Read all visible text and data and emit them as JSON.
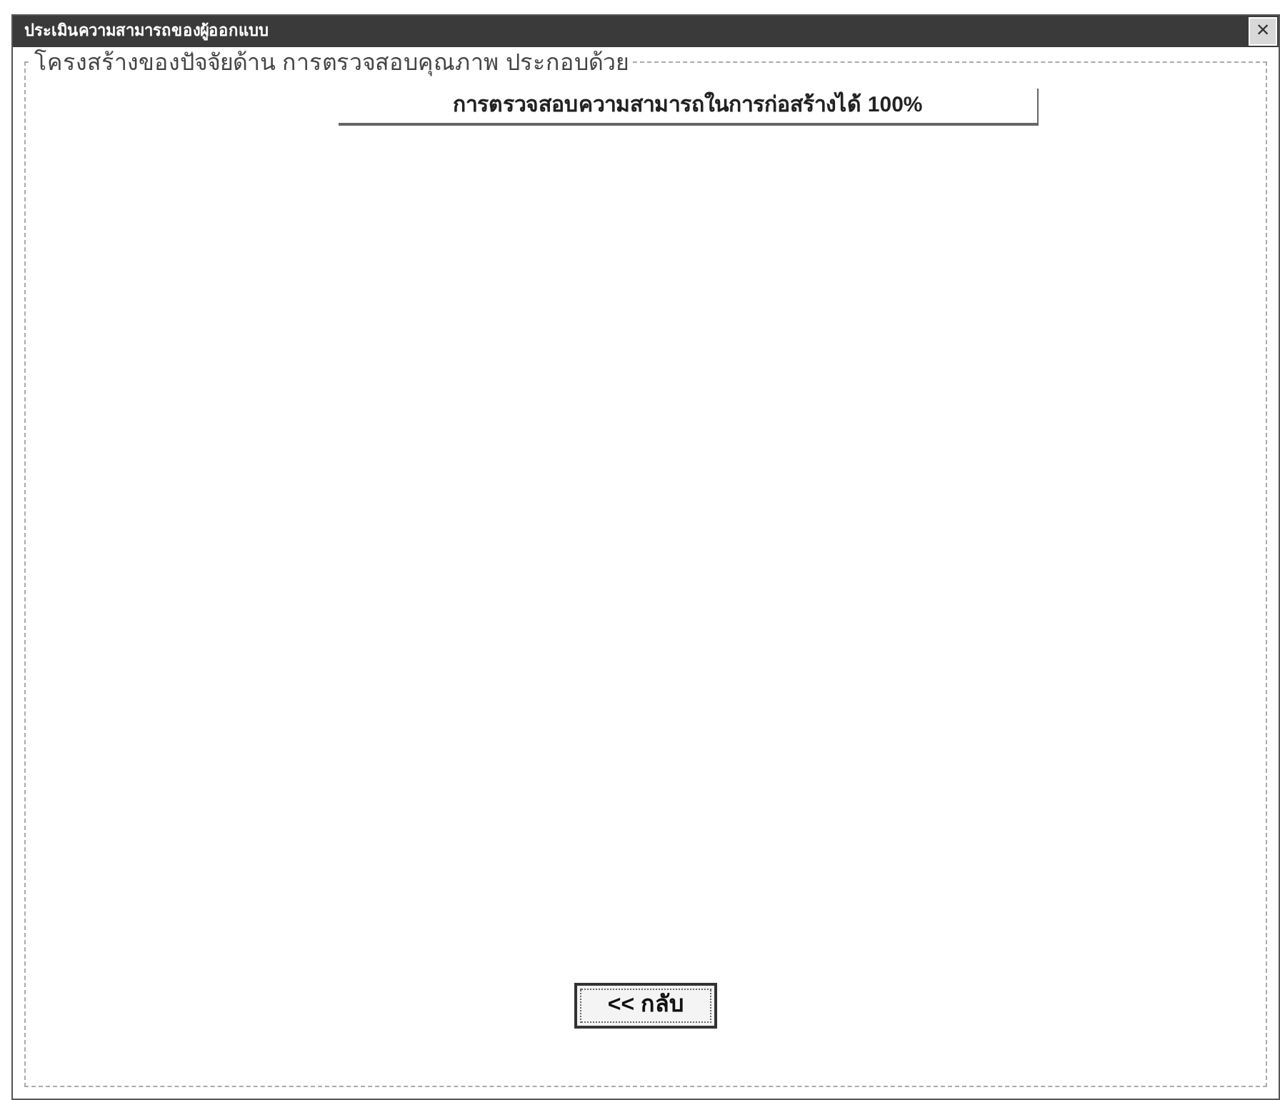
{
  "window": {
    "title": "ประเมินความสามารถของผู้ออกแบบ",
    "close": "×"
  },
  "group": {
    "title": "โครงสร้างของปัจจัยด้าน การตรวจสอบคุณภาพ ประกอบด้วย",
    "items": [
      "การตรวจสอบความสามารถในการก่อสร้างได้ 100%"
    ]
  },
  "buttons": [
    "<< กลับ"
  ]
}
